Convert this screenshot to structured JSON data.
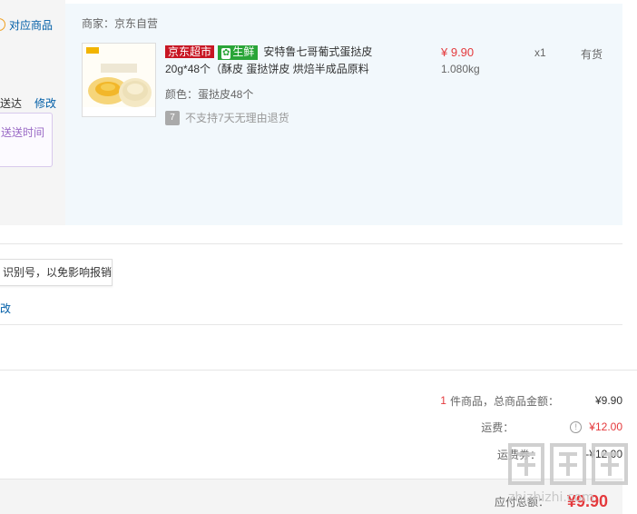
{
  "left": {
    "match_goods": "对应商品",
    "delivery_label": "送达",
    "modify": "修改",
    "time_box_text": "送送时间"
  },
  "shop": {
    "merchant": "商家：京东自营",
    "tag_jd": "京东超市",
    "tag_fresh": "生鲜",
    "title": "安特鲁七哥葡式蛋挞皮20g*48个（酥皮 蛋挞饼皮 烘焙半成品原料",
    "spec": "颜色：蛋挞皮48个",
    "no_return": "不支持7天无理由退货",
    "no_return_icon": "7",
    "price": "¥ 9.90",
    "weight": "1.080kg",
    "qty": "x1",
    "stock": "有货"
  },
  "invoice": {
    "tip": "识别号，以免影响报销",
    "modify": "改"
  },
  "summary": {
    "count": "1",
    "count_label": "件商品，总商品金额：",
    "goods_total": "¥9.90",
    "shipping_label": "运费：",
    "shipping_value": "¥12.00",
    "coupon_label": "运费券：",
    "coupon_value": "-¥12.00",
    "payable_label": "应付总额：",
    "payable_value": "¥9.90"
  },
  "watermark": "zhizhizhi.com",
  "colors": {
    "accent_red": "#e4393c",
    "link_blue": "#005ea7",
    "panel_bg": "#f2f8fc",
    "fresh_green": "#2aa538",
    "jd_red": "#c81623"
  }
}
